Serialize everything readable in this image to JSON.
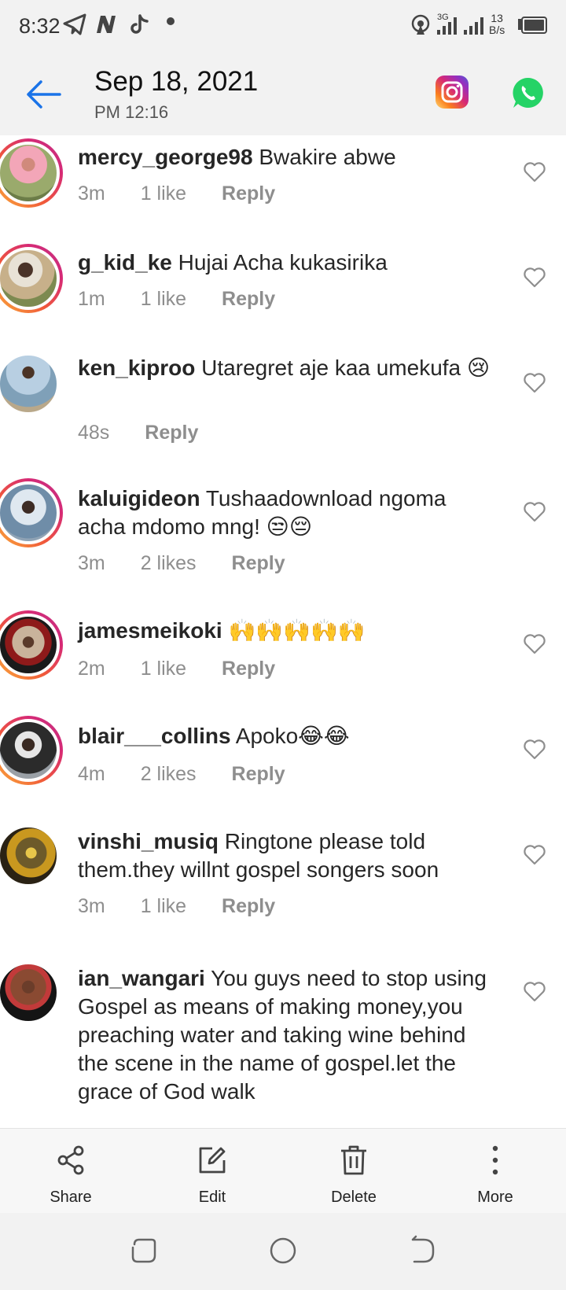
{
  "status_bar": {
    "time": "8:32",
    "network_type": "3G",
    "net_speed_value": "13",
    "net_speed_unit": "B/s",
    "icons": [
      "telegram-icon",
      "n-app-icon",
      "tiktok-icon",
      "hotspot-icon",
      "signal-icon",
      "battery-icon"
    ]
  },
  "header": {
    "date": "Sep 18, 2021",
    "time": "PM 12:16",
    "icons": [
      "back-arrow-icon",
      "instagram-icon",
      "whatsapp-icon"
    ]
  },
  "comments": [
    {
      "username": "mercy_george98",
      "text": "Bwakire abwe",
      "age": "3m",
      "likes": "1 like",
      "reply": "Reply"
    },
    {
      "username": "g_kid_ke",
      "text": "Hujai Acha kukasirika",
      "age": "1m",
      "likes": "1 like",
      "reply": "Reply"
    },
    {
      "username": "ken_kiproo",
      "text": "Utaregret aje kaa umekufa 😢",
      "age": "48s",
      "likes": "",
      "reply": "Reply"
    },
    {
      "username": "kaluigideon",
      "text": "Tushaadownload ngoma acha mdomo mng! 😒😔",
      "age": "3m",
      "likes": "2 likes",
      "reply": "Reply"
    },
    {
      "username": "jamesmeikoki",
      "text": "🙌🙌🙌🙌🙌",
      "age": "2m",
      "likes": "1 like",
      "reply": "Reply"
    },
    {
      "username": "blair___collins",
      "text": "Apoko😂😂",
      "age": "4m",
      "likes": "2 likes",
      "reply": "Reply"
    },
    {
      "username": "vinshi_musiq",
      "text": "Ringtone please told them.they willnt gospel songers soon",
      "age": "3m",
      "likes": "1 like",
      "reply": "Reply"
    },
    {
      "username": "ian_wangari",
      "text": "You guys need to stop using Gospel as means of making money,you preaching water and taking wine behind the scene in the name of gospel.let the grace of God walk",
      "age": "",
      "likes": "",
      "reply": ""
    }
  ],
  "toolbar": {
    "share": "Share",
    "edit": "Edit",
    "delete": "Delete",
    "more": "More"
  },
  "colors": {
    "instagram_ring": "#d62976",
    "back_arrow": "#1a73e8",
    "whatsapp": "#25d366",
    "meta_text": "#8e8e8e"
  }
}
